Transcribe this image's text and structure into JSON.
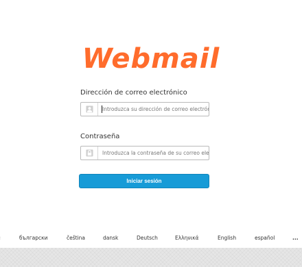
{
  "logo": {
    "text": "Webmail",
    "color": "#ff6c2c"
  },
  "login": {
    "email_label": "Dirección de correo electrónico",
    "email_placeholder": "Introduzca su dirección de correo electrónico.",
    "password_label": "Contraseña",
    "password_placeholder": "Introduzca la contraseña de su correo electrónico.",
    "submit_label": "Iniciar sesión"
  },
  "languages": [
    "български",
    "čeština",
    "dansk",
    "Deutsch",
    "Ελληνικά",
    "English",
    "español",
    "..."
  ],
  "colors": {
    "button": "#179bd7",
    "logo": "#ff6c2c",
    "footer": "#e6e6e6"
  }
}
